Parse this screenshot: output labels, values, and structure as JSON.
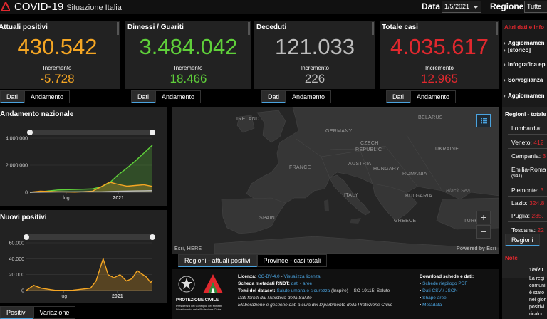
{
  "header": {
    "title": "COVID-19",
    "subtitle": "Situazione Italia",
    "date_label": "Data",
    "date_value": "1/5/2021",
    "region_label": "Regione",
    "region_value": "Tutte"
  },
  "stats": [
    {
      "title": "Attuali positivi",
      "value": "430.542",
      "inc_label": "Incremento",
      "inc": "-5.728",
      "color": "#f5a623",
      "tabs": [
        "Dati",
        "Andamento"
      ]
    },
    {
      "title": "Dimessi / Guariti",
      "value": "3.484.042",
      "inc_label": "Incremento",
      "inc": "18.466",
      "color": "#5fd03a",
      "tabs": [
        "Dati",
        "Andamento"
      ]
    },
    {
      "title": "Deceduti",
      "value": "121.033",
      "inc_label": "Incremento",
      "inc": "226",
      "color": "#bdbdbd",
      "tabs": [
        "Dati",
        "Andamento"
      ]
    },
    {
      "title": "Totale casi",
      "value": "4.035.617",
      "inc_label": "Incremento",
      "inc": "12.965",
      "color": "#e0282e",
      "tabs": [
        "Dati",
        "Andamento"
      ]
    }
  ],
  "chart_data": [
    {
      "type": "area",
      "title": "Andamento nazionale",
      "x_ticks": [
        "lug",
        "2021"
      ],
      "y_ticks": [
        "4.000.000",
        "2.000.000",
        "0"
      ],
      "ylim": [
        0,
        4000000
      ],
      "x_range": [
        "2020-02-24",
        "2021-05-01"
      ],
      "x": [
        "2020-02-24",
        "2020-04-01",
        "2020-06-01",
        "2020-08-01",
        "2020-10-01",
        "2020-11-01",
        "2020-12-01",
        "2021-01-01",
        "2021-02-01",
        "2021-03-01",
        "2021-04-01",
        "2021-05-01"
      ],
      "series": [
        {
          "values": [
            0,
            35000,
            170000,
            205000,
            250000,
            400000,
            700000,
            1300000,
            1800000,
            2300000,
            2900000,
            3484042
          ],
          "color": "#5fd03a"
        },
        {
          "values": [
            0,
            80000,
            40000,
            13000,
            80000,
            400000,
            750000,
            580000,
            450000,
            500000,
            560000,
            430542
          ],
          "color": "#f5a623"
        },
        {
          "values": [
            0,
            13000,
            33000,
            35000,
            36000,
            39000,
            57000,
            75000,
            88000,
            98000,
            110000,
            121033
          ],
          "color": "#bdbdbd"
        }
      ],
      "tabs": []
    },
    {
      "type": "area",
      "title": "Nuovi positivi",
      "x_ticks": [
        "lug",
        "2021"
      ],
      "y_ticks": [
        "60.000",
        "40.000",
        "20.000",
        "0"
      ],
      "ylim": [
        0,
        60000
      ],
      "x_range": [
        "2020-02-24",
        "2021-05-01"
      ],
      "x": [
        "2020-02-24",
        "2020-03-20",
        "2020-04-15",
        "2020-06-01",
        "2020-08-01",
        "2020-10-01",
        "2020-10-20",
        "2020-11-13",
        "2020-11-30",
        "2020-12-20",
        "2021-01-10",
        "2021-02-01",
        "2021-02-20",
        "2021-03-10",
        "2021-03-25",
        "2021-04-10",
        "2021-04-25",
        "2021-05-01"
      ],
      "series": [
        {
          "values": [
            200,
            6500,
            3000,
            300,
            400,
            3000,
            12000,
            40000,
            20000,
            16000,
            20000,
            12000,
            15000,
            25000,
            21000,
            17000,
            10000,
            13000
          ],
          "color": "#f5a623"
        }
      ],
      "tabs": [
        "Positivi",
        "Variazione"
      ]
    }
  ],
  "map": {
    "labels": [
      "IRELAND",
      "BELARUS",
      "GERMANY",
      "CZECH",
      "REPUBLIC",
      "UKRAINE",
      "FRANCE",
      "AUSTRIA",
      "HUNGARY",
      "ROMANIA",
      "Black Sea",
      "ITALY",
      "BULGARIA",
      "SPAIN",
      "GREECE",
      "TURK"
    ],
    "attribution_left": "Esri, HERE",
    "attribution_right": "Powered by Esri",
    "tabs": [
      "Regioni - attuali positivi",
      "Province - casi totali"
    ],
    "zoom_in": "+",
    "zoom_out": "−"
  },
  "footer": {
    "agency_name": "PROTEZIONE CIVILE",
    "agency_sub": "Presidenza del Consiglio dei Ministri",
    "agency_sub2": "Dipartimento della Protezione Civile",
    "licenza_label": "Licenza:",
    "licenza_value": "CC-BY-4.0",
    "licenza_link": "Visualizza licenza",
    "scheda_label": "Scheda metadati RNDT:",
    "scheda_value": "dati",
    "scheda_value2": "aree",
    "temi_label": "Temi del dataset:",
    "temi_value": "Salute umana e sicurezza",
    "temi_rest": "(Inspire) - ISO 19115: Salute",
    "fonte": "Dati forniti dal Ministero della Salute",
    "elaborazione": "Elaborazione e gestione dati a cura del Dipartimento della Protezione Civile",
    "download_title": "Download schede e dati:",
    "downloads": [
      "Schede riepilogo PDF",
      "Dati CSV / JSON",
      "Shape aree",
      "Metadata"
    ]
  },
  "right": {
    "info_title": "Altri dati e info",
    "items": [
      "Aggiornamen",
      "[storico]",
      "Infografica ep",
      "Sorveglianza",
      "Aggiornamen"
    ],
    "regions_title": "Regioni - totale c",
    "regions": [
      {
        "name": "Lombardia:",
        "value": ""
      },
      {
        "name": "Veneto:",
        "value": "412"
      },
      {
        "name": "Campania:",
        "value": "3"
      },
      {
        "name": "Emilia-Roma",
        "value": ""
      },
      {
        "name": "Piemonte:",
        "value": "3"
      },
      {
        "name": "Lazio:",
        "value": "324.8"
      },
      {
        "name": "Puglia:",
        "value": "235."
      },
      {
        "name": "Toscana:",
        "value": "22"
      }
    ],
    "emilia_count": "(941)",
    "tab": "Regioni",
    "note_title": "Note",
    "note_date": "1/5/20",
    "note_lines": [
      "La regi",
      "comuni",
      "è stato",
      "nei gior",
      "positivi",
      "ricalco"
    ]
  }
}
